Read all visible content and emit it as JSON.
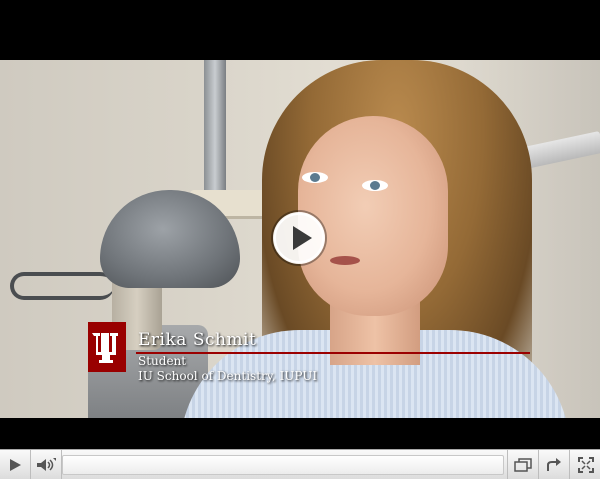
{
  "video": {
    "lower_third": {
      "name": "Erika Schmit",
      "role": "Student",
      "organization": "IU School of Dentistry, IUPUI"
    },
    "logo_icon": "iu-trident-logo",
    "accent_color": "#990000"
  },
  "controls": {
    "play_icon": "play-icon",
    "volume_icon": "volume-icon",
    "progress_fraction": 0,
    "popout_icon": "popout-window-icon",
    "share_icon": "share-icon",
    "fullscreen_icon": "fullscreen-icon"
  }
}
